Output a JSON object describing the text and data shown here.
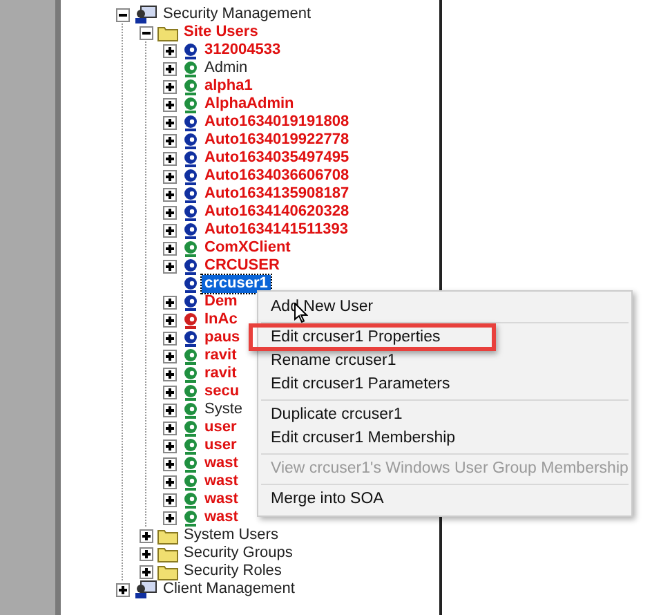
{
  "tree": [
    {
      "label": "Security Management",
      "kind": "group",
      "expandable": true,
      "expanded": true,
      "flagged": false,
      "selected": false,
      "children": [
        {
          "label": "Site Users",
          "kind": "folder",
          "expandable": true,
          "expanded": true,
          "flagged": true,
          "selected": false,
          "children": [
            {
              "label": "312004533",
              "kind": "user",
              "color": "#1030a0",
              "expandable": true,
              "expanded": false,
              "flagged": true,
              "selected": false
            },
            {
              "label": "Admin",
              "kind": "user",
              "color": "#209040",
              "expandable": true,
              "expanded": false,
              "flagged": false,
              "selected": false
            },
            {
              "label": "alpha1",
              "kind": "user",
              "color": "#209040",
              "expandable": true,
              "expanded": false,
              "flagged": true,
              "selected": false
            },
            {
              "label": "AlphaAdmin",
              "kind": "user",
              "color": "#209040",
              "expandable": true,
              "expanded": false,
              "flagged": true,
              "selected": false
            },
            {
              "label": "Auto1634019191808",
              "kind": "user",
              "color": "#1030a0",
              "expandable": true,
              "expanded": false,
              "flagged": true,
              "selected": false
            },
            {
              "label": "Auto1634019922778",
              "kind": "user",
              "color": "#1030a0",
              "expandable": true,
              "expanded": false,
              "flagged": true,
              "selected": false
            },
            {
              "label": "Auto1634035497495",
              "kind": "user",
              "color": "#1030a0",
              "expandable": true,
              "expanded": false,
              "flagged": true,
              "selected": false
            },
            {
              "label": "Auto1634036606708",
              "kind": "user",
              "color": "#1030a0",
              "expandable": true,
              "expanded": false,
              "flagged": true,
              "selected": false
            },
            {
              "label": "Auto1634135908187",
              "kind": "user",
              "color": "#1030a0",
              "expandable": true,
              "expanded": false,
              "flagged": true,
              "selected": false
            },
            {
              "label": "Auto1634140620328",
              "kind": "user",
              "color": "#1030a0",
              "expandable": true,
              "expanded": false,
              "flagged": true,
              "selected": false
            },
            {
              "label": "Auto1634141511393",
              "kind": "user",
              "color": "#1030a0",
              "expandable": true,
              "expanded": false,
              "flagged": true,
              "selected": false
            },
            {
              "label": "ComXClient",
              "kind": "user",
              "color": "#209040",
              "expandable": true,
              "expanded": false,
              "flagged": true,
              "selected": false
            },
            {
              "label": "CRCUSER",
              "kind": "user",
              "color": "#1030a0",
              "expandable": true,
              "expanded": false,
              "flagged": true,
              "selected": false
            },
            {
              "label": "crcuser1",
              "kind": "user",
              "color": "#1030a0",
              "expandable": false,
              "expanded": false,
              "flagged": true,
              "selected": true
            },
            {
              "label": "Dem",
              "kind": "user",
              "color": "#1030a0",
              "expandable": true,
              "expanded": false,
              "flagged": true,
              "selected": false
            },
            {
              "label": "InAc",
              "kind": "user",
              "color": "#d02020",
              "expandable": true,
              "expanded": false,
              "flagged": true,
              "selected": false
            },
            {
              "label": "paus",
              "kind": "user",
              "color": "#1030a0",
              "expandable": true,
              "expanded": false,
              "flagged": true,
              "selected": false
            },
            {
              "label": "ravit",
              "kind": "user",
              "color": "#209040",
              "expandable": true,
              "expanded": false,
              "flagged": true,
              "selected": false
            },
            {
              "label": "ravit",
              "kind": "user",
              "color": "#209040",
              "expandable": true,
              "expanded": false,
              "flagged": true,
              "selected": false
            },
            {
              "label": "secu",
              "kind": "user",
              "color": "#209040",
              "expandable": true,
              "expanded": false,
              "flagged": true,
              "selected": false
            },
            {
              "label": "Syste",
              "kind": "user",
              "color": "#209040",
              "expandable": true,
              "expanded": false,
              "flagged": false,
              "selected": false
            },
            {
              "label": "user",
              "kind": "user",
              "color": "#209040",
              "expandable": true,
              "expanded": false,
              "flagged": true,
              "selected": false
            },
            {
              "label": "user",
              "kind": "user",
              "color": "#209040",
              "expandable": true,
              "expanded": false,
              "flagged": true,
              "selected": false
            },
            {
              "label": "wast",
              "kind": "user",
              "color": "#209040",
              "expandable": true,
              "expanded": false,
              "flagged": true,
              "selected": false
            },
            {
              "label": "wast",
              "kind": "user",
              "color": "#209040",
              "expandable": true,
              "expanded": false,
              "flagged": true,
              "selected": false
            },
            {
              "label": "wast",
              "kind": "user",
              "color": "#209040",
              "expandable": true,
              "expanded": false,
              "flagged": true,
              "selected": false
            },
            {
              "label": "wast",
              "kind": "user",
              "color": "#209040",
              "expandable": true,
              "expanded": false,
              "flagged": true,
              "selected": false
            }
          ]
        },
        {
          "label": "System Users",
          "kind": "folder",
          "expandable": true,
          "expanded": false,
          "flagged": false,
          "selected": false
        },
        {
          "label": "Security Groups",
          "kind": "folder",
          "expandable": true,
          "expanded": false,
          "flagged": false,
          "selected": false
        },
        {
          "label": "Security Roles",
          "kind": "folder",
          "expandable": true,
          "expanded": false,
          "flagged": false,
          "selected": false
        }
      ]
    },
    {
      "label": "Client Management",
      "kind": "group",
      "expandable": true,
      "expanded": false,
      "flagged": false,
      "selected": false
    }
  ],
  "context_menu": {
    "items": [
      {
        "kind": "item",
        "label": "Add New User",
        "disabled": false,
        "highlighted": false
      },
      {
        "kind": "separator"
      },
      {
        "kind": "item",
        "label": "Edit crcuser1 Properties",
        "disabled": false,
        "highlighted": true
      },
      {
        "kind": "item",
        "label": "Rename crcuser1",
        "disabled": false,
        "highlighted": false
      },
      {
        "kind": "item",
        "label": "Edit crcuser1 Parameters",
        "disabled": false,
        "highlighted": false
      },
      {
        "kind": "separator"
      },
      {
        "kind": "item",
        "label": "Duplicate crcuser1",
        "disabled": false,
        "highlighted": false
      },
      {
        "kind": "item",
        "label": "Edit crcuser1 Membership",
        "disabled": false,
        "highlighted": false
      },
      {
        "kind": "separator"
      },
      {
        "kind": "item",
        "label": "View crcuser1's Windows User Group Membership",
        "disabled": true,
        "highlighted": false
      },
      {
        "kind": "separator"
      },
      {
        "kind": "item",
        "label": "Merge into SOA",
        "disabled": false,
        "highlighted": false
      }
    ]
  }
}
